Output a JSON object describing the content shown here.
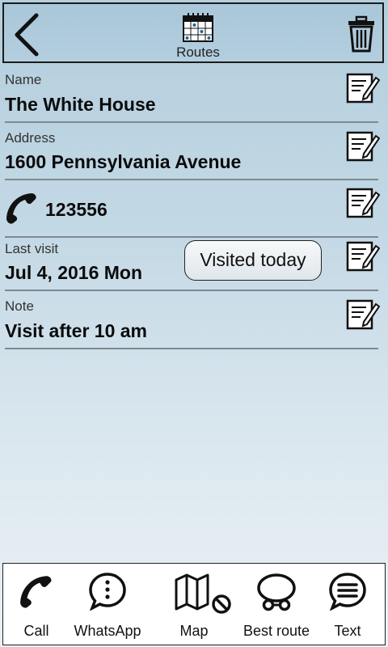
{
  "header": {
    "routes_label": "Routes"
  },
  "fields": {
    "name": {
      "label": "Name",
      "value": "The White House"
    },
    "address": {
      "label": "Address",
      "value": "1600 Pennsylvania Avenue"
    },
    "phone": {
      "value": "123556"
    },
    "last_visit": {
      "label": "Last visit",
      "value": "Jul 4, 2016 Mon",
      "button_label": "Visited today"
    },
    "note": {
      "label": "Note",
      "value": "Visit after 10 am"
    }
  },
  "bottom_nav": {
    "call": "Call",
    "whatsapp": "WhatsApp",
    "map": "Map",
    "best_route": "Best route",
    "text": "Text"
  },
  "icons": [
    "back-arrow-icon",
    "calendar-icon",
    "trash-icon",
    "edit-icon",
    "phone-icon",
    "whatsapp-icon",
    "map-icon",
    "no-entry-icon",
    "best-route-icon",
    "message-icon"
  ]
}
